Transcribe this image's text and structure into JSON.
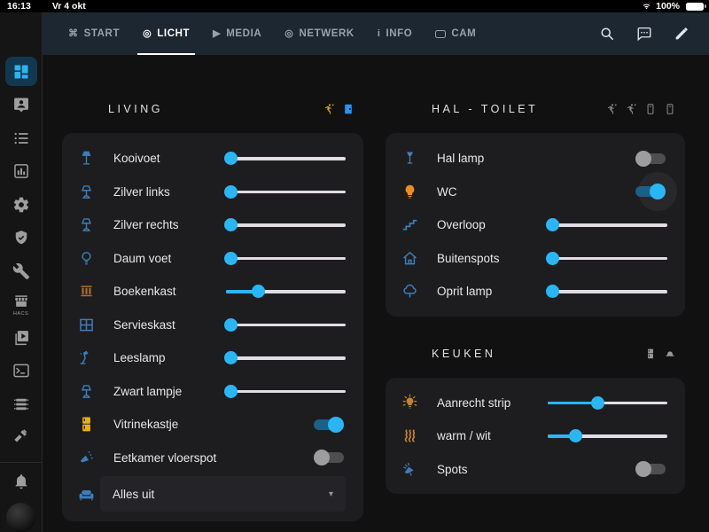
{
  "status_bar": {
    "time": "16:13",
    "date": "Vr 4 okt",
    "battery": "100%",
    "icons": [
      "wifi-icon",
      "battery-icon"
    ]
  },
  "header": {
    "tabs": [
      {
        "id": "start",
        "icon": "command-icon",
        "label": "START",
        "active": false
      },
      {
        "id": "licht",
        "icon": "radiobox-icon",
        "label": "LICHT",
        "active": true
      },
      {
        "id": "media",
        "icon": "play-icon",
        "label": "MEDIA",
        "active": false
      },
      {
        "id": "netwerk",
        "icon": "radiobox-icon",
        "label": "NETWERK",
        "active": false
      },
      {
        "id": "info",
        "icon": "info-icon",
        "label": "INFO",
        "active": false
      },
      {
        "id": "cam",
        "icon": "cam-icon",
        "label": "CAM",
        "active": false
      }
    ],
    "actions": [
      "search-icon",
      "chat-icon",
      "edit-icon"
    ]
  },
  "sidebar": {
    "items": [
      {
        "icon": "dashboard",
        "active": true
      },
      {
        "icon": "badge-account",
        "active": false
      },
      {
        "icon": "list",
        "active": false
      },
      {
        "icon": "chart-box",
        "active": false
      },
      {
        "icon": "cog",
        "active": false
      },
      {
        "icon": "shield-check",
        "active": false
      },
      {
        "icon": "wrench",
        "active": false
      },
      {
        "icon": "hacs",
        "active": false,
        "label": "HACS"
      },
      {
        "icon": "video-box",
        "active": false
      },
      {
        "icon": "terminal",
        "active": false
      },
      {
        "icon": "server",
        "active": false
      },
      {
        "icon": "hammer",
        "active": false
      }
    ],
    "bottom": [
      "bell-icon",
      "avatar"
    ]
  },
  "colors": {
    "accent": "#29b6f6",
    "icon_blue": "#3d7eb8",
    "icon_orange": "#c8822d",
    "icon_yellow": "#e9b115",
    "track": "#e2dde2",
    "header_bg": "#1c2731",
    "card_bg": "#1d1d20"
  },
  "cards": [
    {
      "id": "living",
      "column": 0,
      "title": "LIVING",
      "header_icons": [
        {
          "icon": "motion-run",
          "color": "#d9a61c"
        },
        {
          "icon": "door-lock",
          "color": "#2196f3"
        }
      ],
      "rows": [
        {
          "label": "Kooivoet",
          "icon": "floor-lamp",
          "icon_color": "#3d7eb8",
          "control": {
            "type": "slider",
            "value": 3
          }
        },
        {
          "label": "Zilver links",
          "icon": "table-lamp",
          "icon_color": "#3d7eb8",
          "control": {
            "type": "slider",
            "value": 3
          }
        },
        {
          "label": "Zilver rechts",
          "icon": "table-lamp",
          "icon_color": "#3d7eb8",
          "control": {
            "type": "slider",
            "value": 3
          }
        },
        {
          "label": "Daum voet",
          "icon": "bulb-outline",
          "icon_color": "#3d7eb8",
          "control": {
            "type": "slider",
            "value": 3
          }
        },
        {
          "label": "Boekenkast",
          "icon": "bookshelf",
          "icon_color": "#b5712b",
          "control": {
            "type": "slider",
            "value": 26
          }
        },
        {
          "label": "Servieskast",
          "icon": "window-grid",
          "icon_color": "#3d7eb8",
          "control": {
            "type": "slider",
            "value": 3
          }
        },
        {
          "label": "Leeslamp",
          "icon": "desk-lamp",
          "icon_color": "#3d7eb8",
          "control": {
            "type": "slider",
            "value": 3
          }
        },
        {
          "label": "Zwart lampje",
          "icon": "table-lamp",
          "icon_color": "#3d7eb8",
          "control": {
            "type": "slider",
            "value": 3
          }
        },
        {
          "label": "Vitrinekastje",
          "icon": "fridge",
          "icon_color": "#e9b115",
          "control": {
            "type": "toggle",
            "state": "on"
          }
        },
        {
          "label": "Eetkamer vloerspot",
          "icon": "track-spot",
          "icon_color": "#3d7eb8",
          "control": {
            "type": "toggle",
            "state": "off"
          }
        },
        {
          "label": "Alles uit",
          "icon": "sofa",
          "icon_color": "#3d7eb8",
          "control": {
            "type": "select",
            "value": "Alles uit"
          }
        }
      ]
    },
    {
      "id": "hal-toilet",
      "column": 1,
      "title": "HAL - TOILET",
      "header_icons": [
        {
          "icon": "motion-run",
          "color": "#8b8b8b"
        },
        {
          "icon": "motion-run",
          "color": "#8b8b8b"
        },
        {
          "icon": "door-sensor",
          "color": "#8b8b8b"
        },
        {
          "icon": "door-sensor",
          "color": "#8b8b8b"
        }
      ],
      "rows": [
        {
          "label": "Hal lamp",
          "icon": "torch-lamp",
          "icon_color": "#4a80b5",
          "control": {
            "type": "toggle",
            "state": "off"
          }
        },
        {
          "label": "WC",
          "icon": "bulb",
          "icon_color": "#e88f1e",
          "control": {
            "type": "toggle",
            "state": "on",
            "halo": true
          }
        },
        {
          "label": "Overloop",
          "icon": "stairs",
          "icon_color": "#3d7eb8",
          "control": {
            "type": "slider",
            "value": 3
          }
        },
        {
          "label": "Buitenspots",
          "icon": "house",
          "icon_color": "#3d7eb8",
          "control": {
            "type": "slider",
            "value": 3
          }
        },
        {
          "label": "Oprit lamp",
          "icon": "tree",
          "icon_color": "#3d7eb8",
          "control": {
            "type": "slider",
            "value": 3
          }
        }
      ]
    },
    {
      "id": "keuken",
      "column": 1,
      "title": "KEUKEN",
      "gap_top": true,
      "header_icons": [
        {
          "icon": "fridge-small",
          "color": "#999999"
        },
        {
          "icon": "hood",
          "color": "#999999"
        }
      ],
      "rows": [
        {
          "label": "Aanrecht strip",
          "icon": "bulb-glow",
          "icon_color": "#c8822d",
          "control": {
            "type": "slider",
            "value": 41
          }
        },
        {
          "label": "warm / wit",
          "icon": "heat-waves",
          "icon_color": "#c8822d",
          "control": {
            "type": "slider",
            "value": 22
          }
        },
        {
          "label": "Spots",
          "icon": "ceiling-spot",
          "icon_color": "#3d7eb8",
          "control": {
            "type": "toggle",
            "state": "off"
          }
        }
      ]
    }
  ]
}
